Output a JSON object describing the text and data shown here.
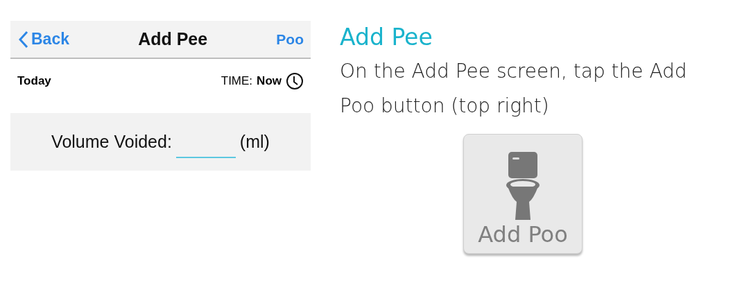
{
  "app_screen": {
    "nav_bar": {
      "back": "Back",
      "title": "Add Pee",
      "action": "Poo"
    },
    "date": "Today",
    "time_label": "TIME:",
    "time_value": "Now",
    "volume": {
      "label": "Volume Voided:",
      "unit": "(ml)"
    }
  },
  "help": {
    "title": "Add Pee",
    "text": "On the Add Pee screen, tap the Add Poo button (top right)",
    "button": "Add Poo"
  }
}
